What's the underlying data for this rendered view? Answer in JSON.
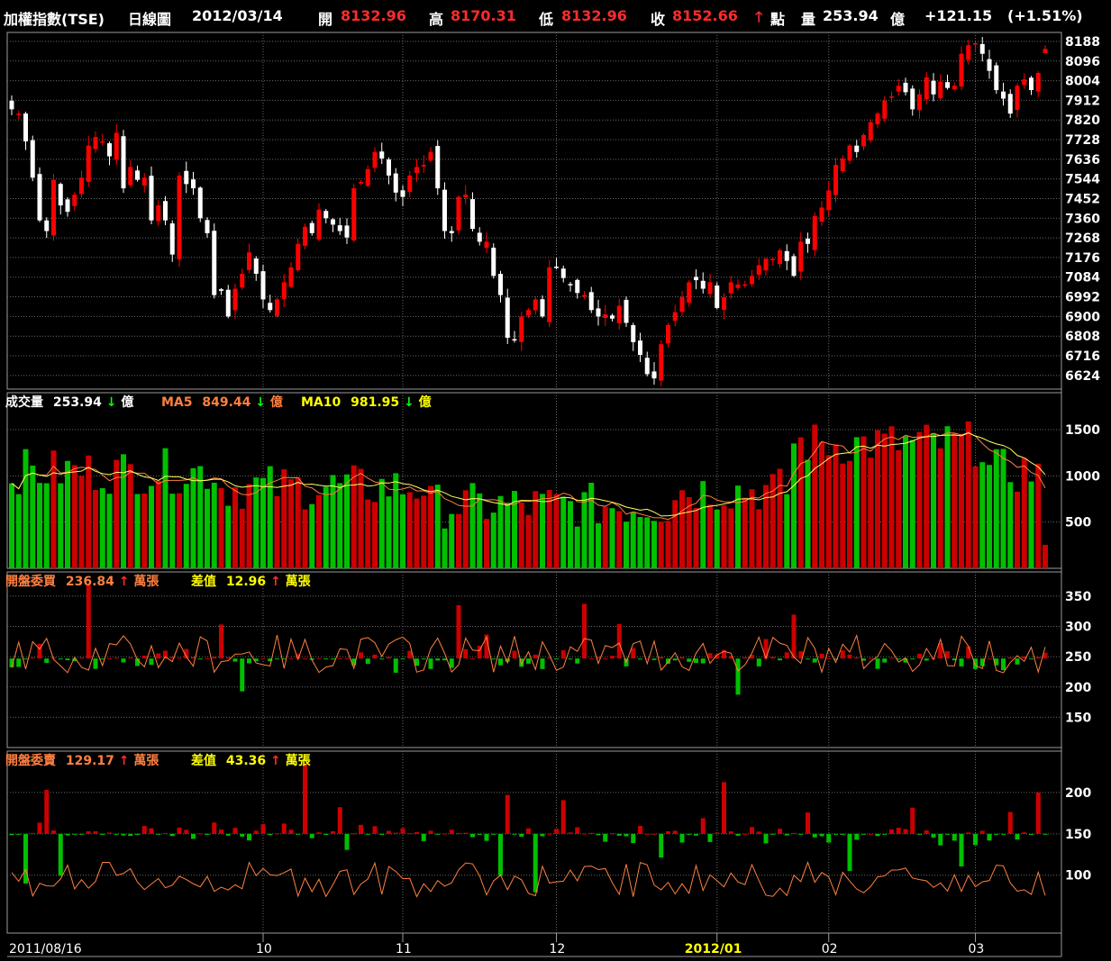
{
  "header": {
    "title": "加權指數(TSE)",
    "period": "日線圖",
    "date": "2012/03/14",
    "open_label": "開",
    "open": "8132.96",
    "high_label": "高",
    "high": "8170.31",
    "low_label": "低",
    "low": "8132.96",
    "close_label": "收",
    "close": "8152.66",
    "close_unit": "點",
    "volume_label": "量",
    "volume": "253.94",
    "volume_unit": "億",
    "change": "+121.15",
    "change_pct": "(+1.51%)"
  },
  "panels": {
    "volume": {
      "label": "成交量",
      "value": "253.94",
      "unit": "億",
      "ma5_label": "MA5",
      "ma5": "849.44",
      "ma10_label": "MA10",
      "ma10": "981.95"
    },
    "buy": {
      "label": "開盤委買",
      "value": "236.84",
      "unit": "萬張",
      "diff_label": "差值",
      "diff": "12.96"
    },
    "sell": {
      "label": "開盤委賣",
      "value": "129.17",
      "unit": "萬張",
      "diff_label": "差值",
      "diff": "43.36"
    }
  },
  "colors": {
    "up": "#ff0000",
    "down": "#ffffff",
    "vol_up": "#cc0000",
    "vol_down": "#00c000",
    "ma5": "#ff8040",
    "ma10": "#ffff66",
    "grid": "#6a6a6a",
    "frame": "#9a9a9a"
  },
  "chart_data": [
    {
      "type": "candlestick",
      "ylim": [
        6560,
        8230
      ],
      "yticks": [
        8188,
        8096,
        8004,
        7912,
        7820,
        7728,
        7636,
        7544,
        7452,
        7360,
        7268,
        7176,
        7084,
        6992,
        6900,
        6808,
        6716,
        6624
      ],
      "grid": true,
      "x_labels": [
        {
          "day": 0,
          "text": "2011/08/16"
        },
        {
          "day": 36,
          "text": "10"
        },
        {
          "day": 56,
          "text": "11"
        },
        {
          "day": 78,
          "text": "12"
        },
        {
          "day": 101,
          "text": "2012/01"
        },
        {
          "day": 117,
          "text": "02"
        },
        {
          "day": 138,
          "text": "03"
        }
      ],
      "close": [
        7870,
        7850,
        7720,
        7550,
        7350,
        7300,
        7540,
        7420,
        7390,
        7470,
        7550,
        7700,
        7740,
        7720,
        7650,
        7760,
        7500,
        7600,
        7540,
        7550,
        7350,
        7420,
        7350,
        7190,
        7560,
        7520,
        7500,
        7360,
        7290,
        7000,
        7020,
        6900,
        7030,
        7100,
        7200,
        7100,
        6980,
        6930,
        6980,
        7060,
        7130,
        7240,
        7320,
        7290,
        7400,
        7360,
        7330,
        7300,
        7270,
        7500,
        7530,
        7590,
        7670,
        7640,
        7560,
        7480,
        7460,
        7560,
        7600,
        7610,
        7670,
        7500,
        7300,
        7290,
        7460,
        7470,
        7310,
        7250,
        7250,
        7090,
        7000,
        6800,
        6790,
        6900,
        6930,
        6980,
        6900,
        7130,
        7130,
        7080,
        7050,
        7010,
        7000,
        6930,
        6900,
        6910,
        6890,
        6950,
        6870,
        6780,
        6720,
        6630,
        6610,
        6770,
        6860,
        6920,
        6990,
        7060,
        7070,
        7030,
        7060,
        6940,
        6990,
        7060,
        7050,
        7050,
        7090,
        7140,
        7170,
        7170,
        7210,
        7160,
        7090,
        7250,
        7240,
        7370,
        7410,
        7490,
        7610,
        7640,
        7700,
        7670,
        7750,
        7810,
        7850,
        7910,
        7930,
        7980,
        7950,
        7870,
        7940,
        8020,
        7940,
        8000,
        7970,
        7980,
        8130,
        8170,
        8180,
        8130,
        8050,
        7960,
        7920,
        7850,
        7980,
        8010,
        7960,
        8040,
        8153
      ],
      "note": "149 daily OHLC bars, open/high/low read approximately from the chart"
    },
    {
      "type": "bar+line",
      "name": "成交量",
      "ylim": [
        0,
        1900
      ],
      "yticks": [
        500,
        1000,
        1500
      ]
    },
    {
      "type": "bar+line",
      "name": "開盤委買",
      "ylim": [
        100,
        390
      ],
      "baseline": 247,
      "yticks": [
        150,
        200,
        250,
        300,
        350
      ]
    },
    {
      "type": "bar+line",
      "name": "開盤委賣",
      "ylim": [
        30,
        250
      ],
      "baseline": 150,
      "yticks": [
        100,
        150,
        200
      ]
    }
  ]
}
